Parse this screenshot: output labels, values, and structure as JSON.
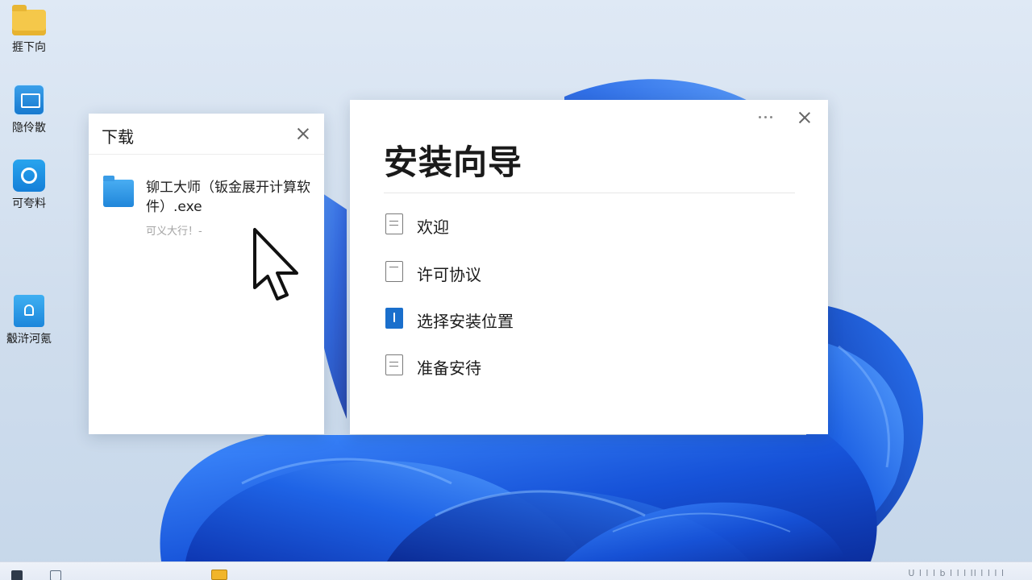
{
  "desktop": {
    "icons": [
      {
        "label": "捱下向",
        "icon": "folder-icon"
      },
      {
        "label": "隐伶散",
        "icon": "app-window-icon"
      },
      {
        "label": "可夸料",
        "icon": "app-chat-icon"
      },
      {
        "label": "觳浒河氪",
        "icon": "app-document-icon"
      }
    ]
  },
  "downloads": {
    "title": "下载",
    "item": {
      "name": "铆工大师（钣金展开计算软件）.exe",
      "status": "可义大行！-"
    }
  },
  "wizard": {
    "title": "安装向导",
    "steps": [
      {
        "label": "欢迎",
        "active": false
      },
      {
        "label": "许可协议",
        "active": false
      },
      {
        "label": "选择安装位置",
        "active": true
      },
      {
        "label": "准备安待",
        "active": false
      }
    ]
  },
  "taskbar": {
    "tray_text": "U   l l l   b l l l ll l   l l l"
  },
  "colors": {
    "accent": "#1a6fcc",
    "wallpaper_bloom": "#1b5fe0",
    "folder": "#f5c84a"
  }
}
